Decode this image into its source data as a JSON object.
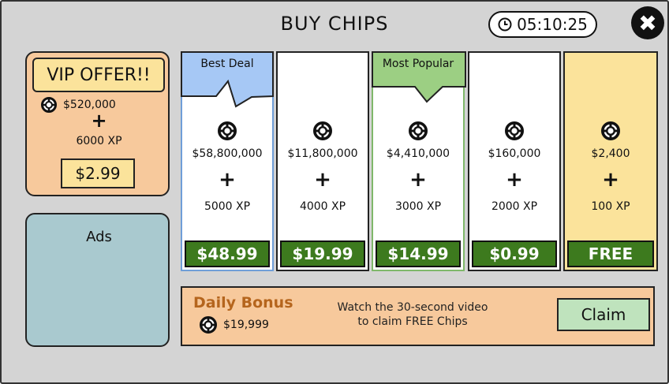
{
  "header": {
    "title": "BUY CHIPS",
    "timer": "05:10:25"
  },
  "vip": {
    "title": "VIP OFFER!!",
    "chips": "$520,000",
    "plus": "+",
    "xp": "6000 XP",
    "price": "$2.99"
  },
  "ads": {
    "label": "Ads"
  },
  "packages": [
    {
      "tag": "Best Deal",
      "amount": "$58,800,000",
      "plus": "+",
      "xp": "5000 XP",
      "price": "$48.99"
    },
    {
      "tag": "",
      "amount": "$11,800,000",
      "plus": "+",
      "xp": "4000 XP",
      "price": "$19.99"
    },
    {
      "tag": "Most Popular",
      "amount": "$4,410,000",
      "plus": "+",
      "xp": "3000 XP",
      "price": "$14.99"
    },
    {
      "tag": "",
      "amount": "$160,000",
      "plus": "+",
      "xp": "2000 XP",
      "price": "$0.99"
    },
    {
      "tag": "",
      "amount": "$2,400",
      "plus": "+",
      "xp": "100 XP",
      "price": "FREE"
    }
  ],
  "daily_bonus": {
    "title": "Daily Bonus",
    "chips": "$19,999",
    "message_line1": "Watch the 30-second video",
    "message_line2": "to claim FREE Chips",
    "claim_label": "Claim"
  },
  "colors": {
    "background": "#d4d4d4",
    "vip": "#f7c99c",
    "vip_label": "#fbe39b",
    "ads": "#a9c9cf",
    "price_button": "#3d7a1e",
    "best_deal_tag": "#a6c8f5",
    "most_popular_tag": "#9ccf83",
    "free_card": "#fbe39b",
    "claim_button": "#bfe3bd",
    "daily_title": "#b5651d"
  },
  "icons": {
    "clock": "clock-icon",
    "close": "close-icon",
    "chip": "chip-icon"
  }
}
